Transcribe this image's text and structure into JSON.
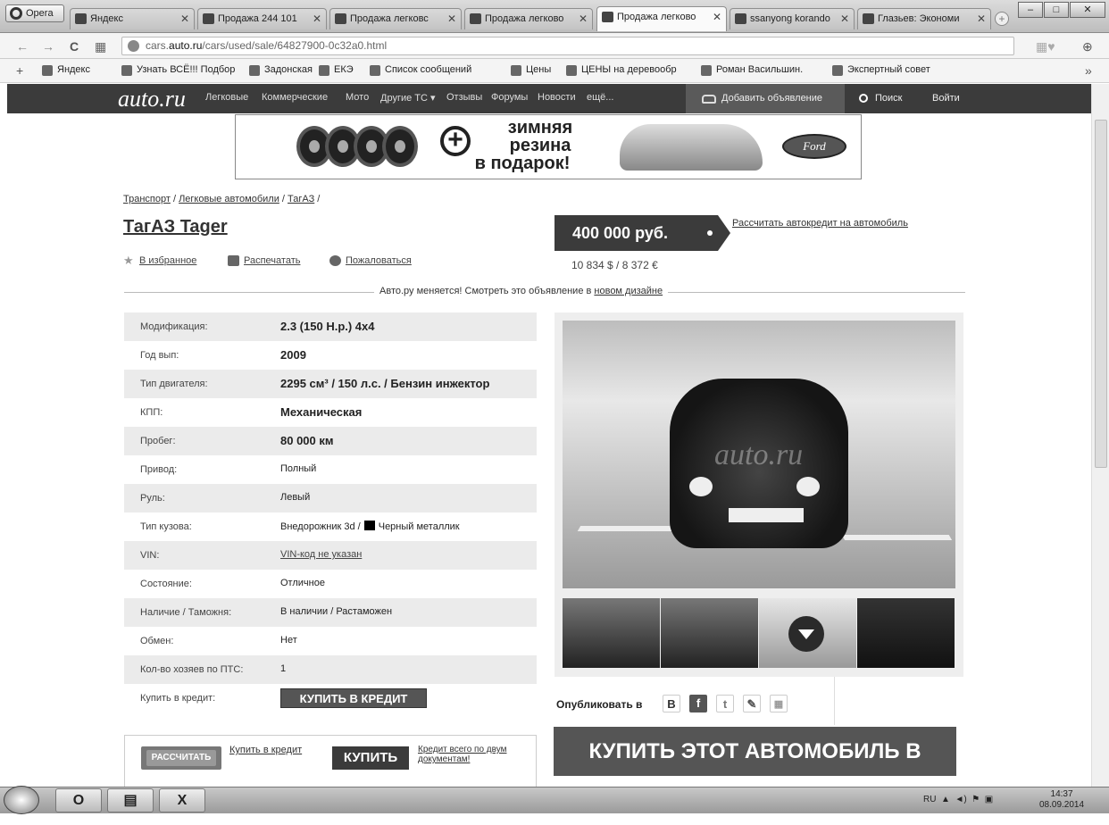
{
  "browser": {
    "opera_label": "Opera",
    "tabs": [
      {
        "label": "Яндекс"
      },
      {
        "label": "Продажа 244 101"
      },
      {
        "label": "Продажа легковс"
      },
      {
        "label": "Продажа легково"
      },
      {
        "label": "Продажа легково"
      },
      {
        "label": "ssanyong korando"
      },
      {
        "label": "Глазьев: Экономи"
      }
    ],
    "url_prefix": "cars.",
    "url_domain": "auto.ru",
    "url_path": "/cars/used/sale/64827900-0c32a0.html",
    "bookmarks": [
      "Яндекс",
      "Узнать ВСЁ!!! Подбор",
      "Задонская",
      "ЕКЭ",
      "Список сообщений",
      "Цены",
      "ЦЕНЫ на деревообр",
      "Роман Васильшин.",
      "Экспертный совет"
    ],
    "bookmark_more": "»"
  },
  "site": {
    "logo": "auto.ru",
    "nav": [
      "Легковые",
      "Коммерческие",
      "Мото",
      "Другие ТС ▾",
      "Отзывы",
      "Форумы",
      "Новости",
      "ещё..."
    ],
    "add_listing": "Добавить объявление",
    "search": "Поиск",
    "login": "Войти"
  },
  "banner": {
    "line1": "зимняя",
    "line2": "резина",
    "line3": "в подарок!",
    "brand": "Ford"
  },
  "listing": {
    "breadcrumbs": [
      "Транспорт",
      "Легковые автомобили",
      "ТагАЗ"
    ],
    "title": "ТагАЗ Tager",
    "actions": [
      "В избранное",
      "Распечатать",
      "Пожаловаться"
    ],
    "price": "400 000 руб.",
    "price_alt": "10 834 $ / 8 372 €",
    "credit_calc_link": "Рассчитать автокредит на автомобиль",
    "redesign_text": "Авто.ру меняется! Смотреть это объявление в ",
    "redesign_link": "новом дизайне"
  },
  "specs": [
    {
      "key": "Модификация:",
      "value": "2.3 (150 Н.р.) 4x4"
    },
    {
      "key": "Год вып:",
      "value": "2009"
    },
    {
      "key": "Тип двигателя:",
      "value": "2295 см³ / 150 л.с. / Бензин инжектор"
    },
    {
      "key": "КПП:",
      "value": "Механическая"
    },
    {
      "key": "Пробег:",
      "value": "80 000 км"
    },
    {
      "key": "Привод:",
      "value": "Полный"
    },
    {
      "key": "Руль:",
      "value": "Левый"
    },
    {
      "key": "Тип кузова:",
      "value": "Внедорожник 3d /",
      "color": "Черный металлик"
    },
    {
      "key": "VIN:",
      "value": "VIN-код не указан"
    },
    {
      "key": "Состояние:",
      "value": "Отличное"
    },
    {
      "key": "Наличие / Таможня:",
      "value": "В наличии / Растаможен"
    },
    {
      "key": "Обмен:",
      "value": "Нет"
    },
    {
      "key": "Кол-во хозяев по ПТС:",
      "value": "1"
    },
    {
      "key": "Купить в кредит:",
      "value": "КУПИТЬ В КРЕДИТ"
    }
  ],
  "bottom": {
    "calc_btn": "РАССЧИТАТЬ",
    "calc_link": "Купить в кредит",
    "buy_btn": "КУПИТЬ",
    "credit_docs": "Кредит всего по двум документам!",
    "share_label": "Опубликовать в",
    "share_icons": [
      "В",
      "f",
      "t",
      "✎",
      "▦"
    ],
    "big_credit": "КУПИТЬ ЭТОТ АВТОМОБИЛЬ В КРЕДИТ"
  },
  "photo": {
    "watermark": "auto.ru"
  },
  "taskbar": {
    "lang": "RU",
    "time": "14:37",
    "date": "08.09.2014"
  },
  "colors": {
    "nav_bg": "#3b3b3b",
    "price_bg": "#3b3b3b",
    "credit_bg": "#555555"
  }
}
